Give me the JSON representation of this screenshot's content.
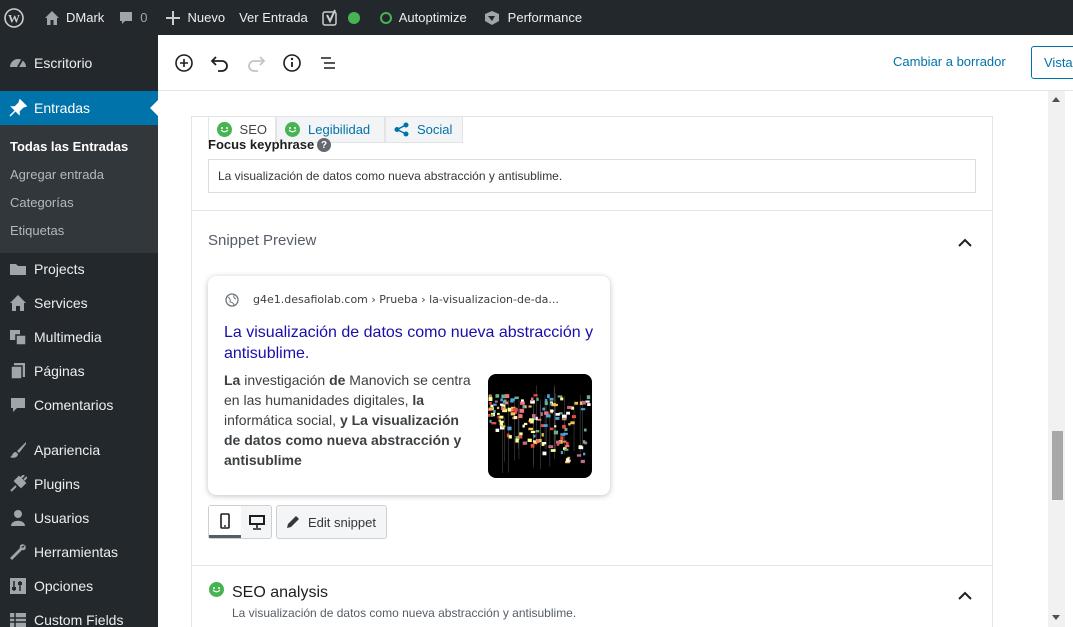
{
  "admin_bar": {
    "site_name": "DMark",
    "comments_count": "0",
    "new_label": "Nuevo",
    "view_entry_label": "Ver Entrada",
    "autoptimize_label": "Autoptimize",
    "performance_label": "Performance"
  },
  "sidebar": {
    "items": [
      {
        "label": "Escritorio",
        "icon": "dashboard-icon"
      },
      {
        "label": "Entradas",
        "icon": "pin-icon",
        "current": true
      },
      {
        "label": "Projects",
        "icon": "folder-icon"
      },
      {
        "label": "Services",
        "icon": "home-icon"
      },
      {
        "label": "Multimedia",
        "icon": "media-icon"
      },
      {
        "label": "Páginas",
        "icon": "page-icon"
      },
      {
        "label": "Comentarios",
        "icon": "comment-icon"
      },
      {
        "label": "Apariencia",
        "icon": "brush-icon"
      },
      {
        "label": "Plugins",
        "icon": "plug-icon"
      },
      {
        "label": "Usuarios",
        "icon": "user-icon"
      },
      {
        "label": "Herramientas",
        "icon": "wrench-icon"
      },
      {
        "label": "Opciones",
        "icon": "settings-icon"
      },
      {
        "label": "Custom Fields",
        "icon": "table-icon"
      }
    ],
    "submenu": [
      "Todas las Entradas",
      "Agregar entrada",
      "Categorías",
      "Etiquetas"
    ]
  },
  "toolbar": {
    "draft_label": "Cambiar a borrador",
    "preview_label": "Vista"
  },
  "yoast": {
    "tabs": [
      "SEO",
      "Legibilidad",
      "Social"
    ],
    "focus_label": "Focus keyphrase",
    "focus_value": "La visualización de datos como nueva abstracción y antisublime.",
    "snippet_title": "Snippet Preview",
    "serp": {
      "url": "g4e1.desafiolab.com › Prueba › la-visualizacion-de-da...",
      "title": "La visualización de datos como nueva abstracción y antisublime.",
      "desc_parts": [
        {
          "t": "La",
          "b": true
        },
        {
          "t": " investigación ",
          "b": false
        },
        {
          "t": "de",
          "b": true
        },
        {
          "t": " Manovich se centra en las humanidades digitales, ",
          "b": false
        },
        {
          "t": "la",
          "b": true
        },
        {
          "t": " informática social, ",
          "b": false
        },
        {
          "t": "y La visualización de datos como nueva abstracción y antisublime",
          "b": true
        }
      ]
    },
    "edit_snippet_label": "Edit snippet",
    "seo_analysis_title": "SEO analysis",
    "seo_analysis_sub": "La visualización de datos como nueva abstracción y antisublime."
  },
  "colors": {
    "admin_dark": "#23282d",
    "accent": "#0073aa",
    "good": "#46b450",
    "serp_title": "#1a0dab"
  }
}
